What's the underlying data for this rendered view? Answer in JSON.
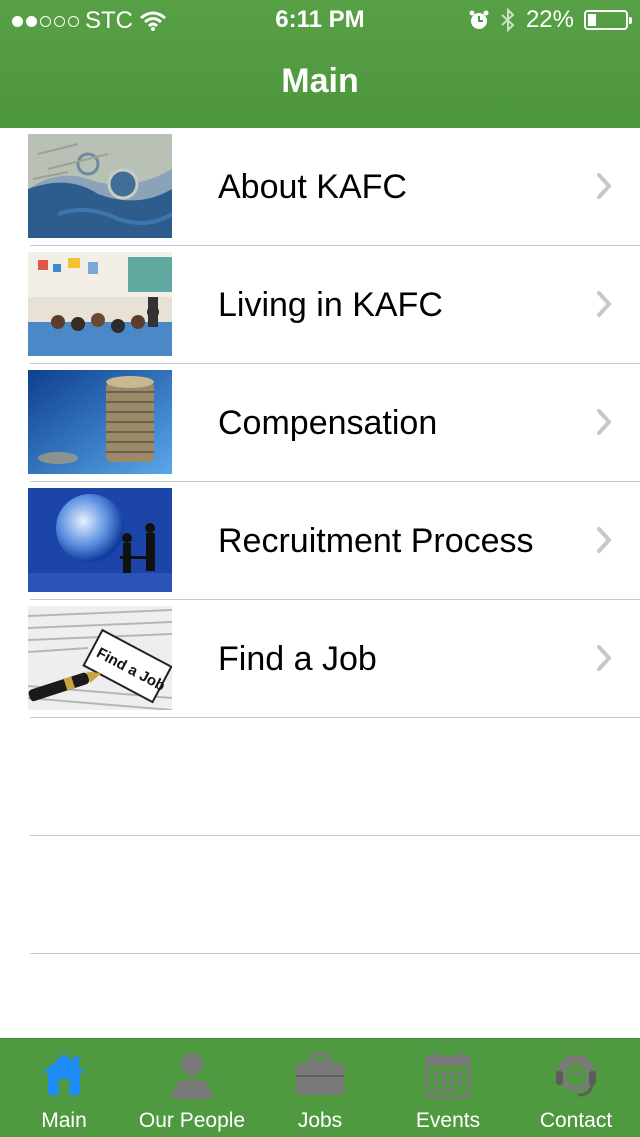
{
  "status_bar": {
    "carrier": "STC",
    "time": "6:11 PM",
    "battery_percent": "22%",
    "battery_level": 0.22
  },
  "nav": {
    "title": "Main"
  },
  "menu": {
    "items": [
      {
        "label": "About KAFC",
        "image": "aerial-city-photo"
      },
      {
        "label": "Living in KAFC",
        "image": "classroom-photo"
      },
      {
        "label": "Compensation",
        "image": "coin-stacks-photo"
      },
      {
        "label": "Recruitment Process",
        "image": "globe-business-photo"
      },
      {
        "label": "Find a Job",
        "image": "find-a-job-newspaper-photo"
      }
    ]
  },
  "tabbar": {
    "active_color": "#1f8cf5",
    "inactive_color": "#7a7a7a",
    "tabs": [
      {
        "label": "Main",
        "icon": "home-icon",
        "active": true
      },
      {
        "label": "Our People",
        "icon": "person-icon",
        "active": false
      },
      {
        "label": "Jobs",
        "icon": "briefcase-icon",
        "active": false
      },
      {
        "label": "Events",
        "icon": "calendar-icon",
        "active": false
      },
      {
        "label": "Contact",
        "icon": "headset-icon",
        "active": false
      }
    ]
  },
  "colors": {
    "header_green": "#4f9a40",
    "separator": "#c8c7cc"
  }
}
